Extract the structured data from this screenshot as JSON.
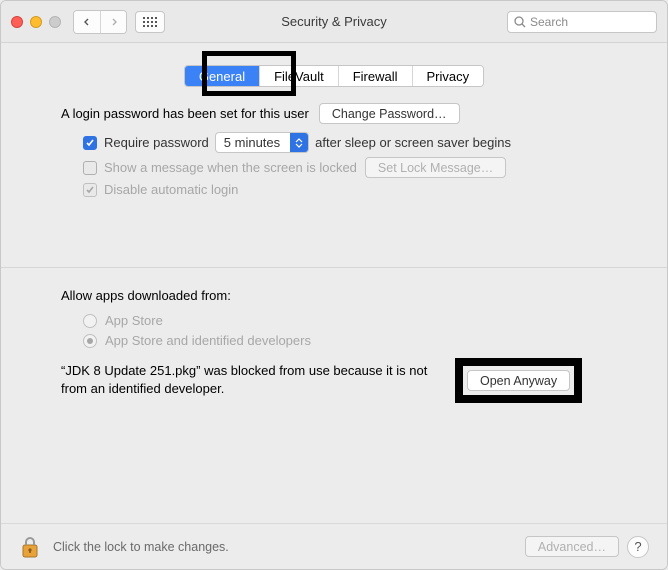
{
  "window": {
    "title": "Security & Privacy"
  },
  "search": {
    "placeholder": "Search"
  },
  "tabs": {
    "items": [
      "General",
      "FileVault",
      "Firewall",
      "Privacy"
    ],
    "active": 0
  },
  "login": {
    "message": "A login password has been set for this user",
    "change_password_label": "Change Password…",
    "require_password_label": "Require password",
    "require_password_checked": true,
    "delay_value": "5 minutes",
    "after_sleep_label": "after sleep or screen saver begins",
    "show_message_label": "Show a message when the screen is locked",
    "show_message_checked": false,
    "set_lock_message_label": "Set Lock Message…",
    "disable_auto_login_label": "Disable automatic login",
    "disable_auto_login_checked": true
  },
  "allow": {
    "title": "Allow apps downloaded from:",
    "options": [
      "App Store",
      "App Store and identified developers"
    ],
    "selected": 1,
    "blocked_message": "“JDK 8 Update 251.pkg” was blocked from use because it is not from an identified developer.",
    "open_anyway_label": "Open Anyway"
  },
  "footer": {
    "lock_message": "Click the lock to make changes.",
    "advanced_label": "Advanced…"
  }
}
